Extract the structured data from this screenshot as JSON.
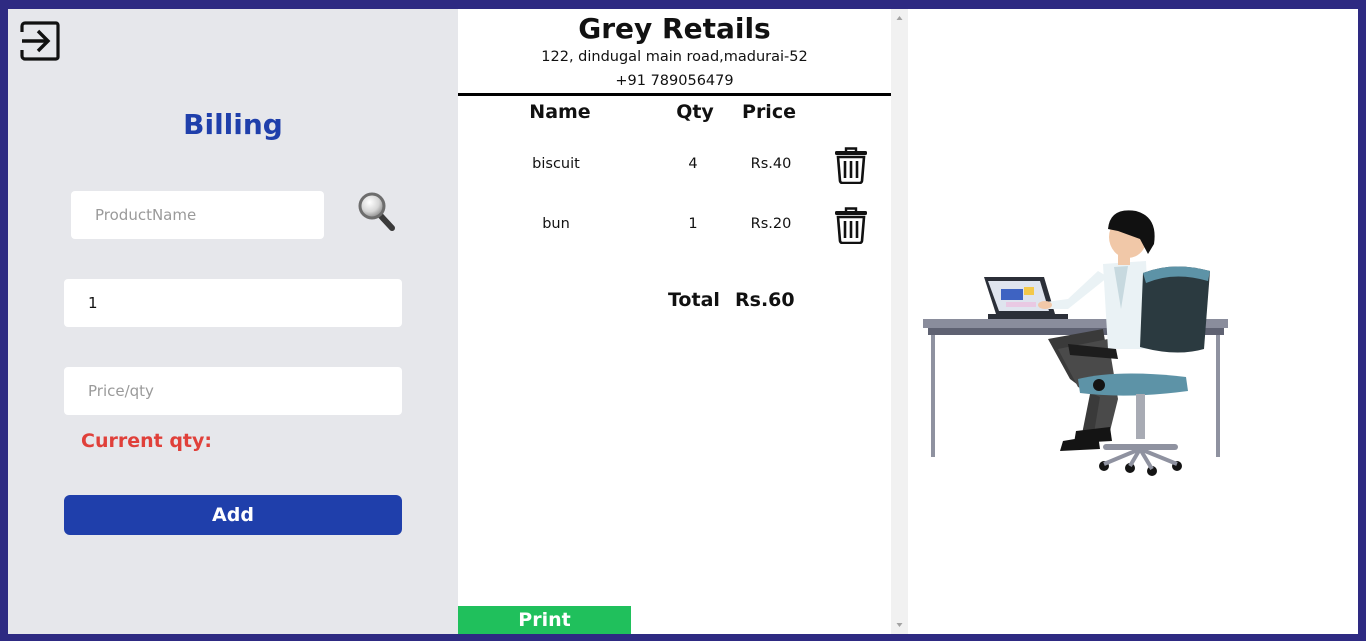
{
  "sidebar": {
    "title": "Billing",
    "product_placeholder": "ProductName",
    "qty_value": "1",
    "price_placeholder": "Price/qty",
    "current_qty_label": "Current qty:",
    "add_label": "Add"
  },
  "receipt": {
    "shop_name": "Grey Retails",
    "address": "122, dindugal main road,madurai-52",
    "phone": "+91 789056479",
    "columns": [
      "Name",
      "Qty",
      "Price"
    ],
    "items": [
      {
        "name": "biscuit",
        "qty": "4",
        "price": "Rs.40"
      },
      {
        "name": "bun",
        "qty": "1",
        "price": "Rs.20"
      }
    ],
    "total_label": "Total",
    "total_value": "Rs.60",
    "print_label": "Print"
  },
  "colors": {
    "accent": "#1f3fab",
    "warning": "#e0403a",
    "print": "#20c05c",
    "frame": "#2e2a82",
    "panel": "#e6e7eb"
  },
  "icons": {
    "logout": "logout-icon",
    "search": "magnifier-icon",
    "delete": "trash-icon"
  }
}
